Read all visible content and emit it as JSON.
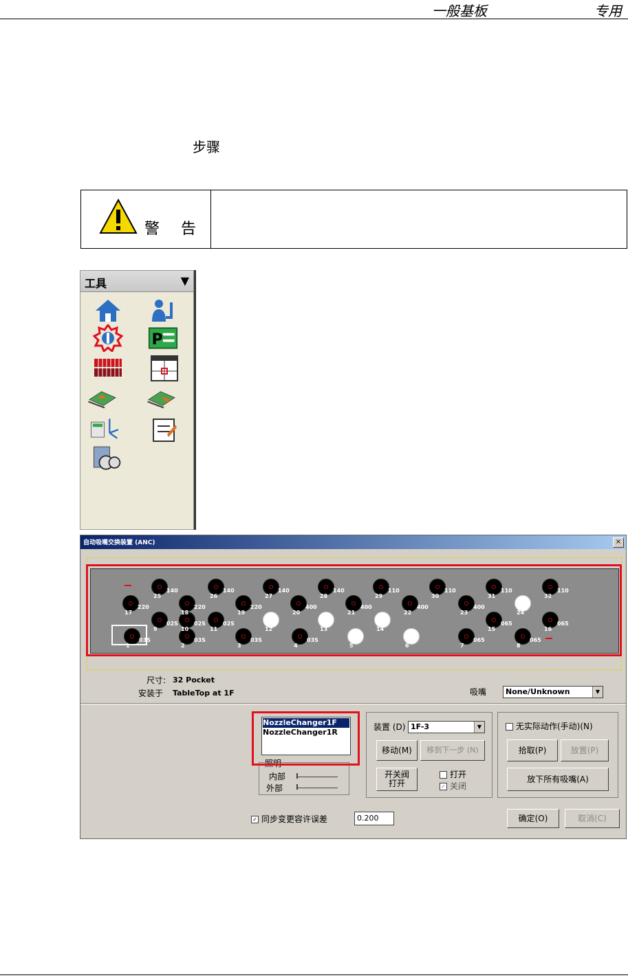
{
  "header": {
    "left": "一般基板",
    "right": "专用"
  },
  "step_title": "步骤",
  "warning": {
    "label": "警 告"
  },
  "tool_panel": {
    "title": "工具",
    "dropdown_arrow": "▼",
    "icons": [
      "home-icon",
      "operator-icon",
      "nozzle-changer-icon",
      "program-icon",
      "feeder-grid-icon",
      "vision-window-icon",
      "board-transfer-icon",
      "board-transfer-2-icon",
      "axis-calibration-icon",
      "checklist-icon",
      "nozzle-stocker-icon"
    ]
  },
  "dialog": {
    "title": "自动吸嘴交换装置 (ANC)",
    "close": "×",
    "pockets": [
      {
        "num": "1",
        "type": "03S",
        "state": "nozzle"
      },
      {
        "num": "2",
        "type": "03S",
        "state": "nozzle"
      },
      {
        "num": "3",
        "type": "03S",
        "state": "nozzle"
      },
      {
        "num": "4",
        "type": "03S",
        "state": "nozzle"
      },
      {
        "num": "5",
        "type": "",
        "state": "empty"
      },
      {
        "num": "6",
        "type": "",
        "state": "empty"
      },
      {
        "num": "7",
        "type": "065",
        "state": "nozzle"
      },
      {
        "num": "8",
        "type": "065",
        "state": "nozzle"
      },
      {
        "num": "9",
        "type": "02S",
        "state": "nozzle"
      },
      {
        "num": "10",
        "type": "02S",
        "state": "nozzle"
      },
      {
        "num": "11",
        "type": "02S",
        "state": "nozzle"
      },
      {
        "num": "12",
        "type": "",
        "state": "empty"
      },
      {
        "num": "13",
        "type": "",
        "state": "empty"
      },
      {
        "num": "14",
        "type": "",
        "state": "empty"
      },
      {
        "num": "15",
        "type": "065",
        "state": "nozzle"
      },
      {
        "num": "16",
        "type": "065",
        "state": "nozzle"
      },
      {
        "num": "17",
        "type": "220",
        "state": "nozzle"
      },
      {
        "num": "18",
        "type": "220",
        "state": "nozzle"
      },
      {
        "num": "19",
        "type": "220",
        "state": "nozzle"
      },
      {
        "num": "20",
        "type": "400",
        "state": "nozzle"
      },
      {
        "num": "21",
        "type": "400",
        "state": "nozzle"
      },
      {
        "num": "22",
        "type": "400",
        "state": "nozzle"
      },
      {
        "num": "23",
        "type": "400",
        "state": "nozzle"
      },
      {
        "num": "24",
        "type": "",
        "state": "empty"
      },
      {
        "num": "25",
        "type": "140",
        "state": "nozzle"
      },
      {
        "num": "26",
        "type": "140",
        "state": "nozzle"
      },
      {
        "num": "27",
        "type": "140",
        "state": "nozzle"
      },
      {
        "num": "28",
        "type": "140",
        "state": "nozzle"
      },
      {
        "num": "29",
        "type": "110",
        "state": "nozzle"
      },
      {
        "num": "30",
        "type": "110",
        "state": "nozzle"
      },
      {
        "num": "31",
        "type": "110",
        "state": "nozzle"
      },
      {
        "num": "32",
        "type": "110",
        "state": "nozzle"
      }
    ],
    "size_label": "尺寸:",
    "size_value": "32 Pocket",
    "mount_label": "安装于",
    "mount_value": "TableTop at 1F",
    "nozzle_label": "吸嘴",
    "nozzle_value": "None/Unknown",
    "changers": [
      "NozzleChanger1F",
      "NozzleChanger1R"
    ],
    "lighting": {
      "title": "照明",
      "inner": "内部",
      "outer": "外部"
    },
    "device_label": "装置 (D)",
    "device_value": "1F-3",
    "move_button": "移动(M)",
    "move_next_button": "移到下一步 (N)",
    "valve_button_line1": "开关阀",
    "valve_button_line2": "打开",
    "open_label": "打开",
    "close_label": "关闭",
    "no_action_label": "无实际动作(手动)(N)",
    "pick_button": "拾取(P)",
    "place_button": "放置(P)",
    "drop_all_button": "放下所有吸嘴(A)",
    "sync_label": "同步变更容许误差",
    "sync_value": "0.200",
    "ok_button": "确定(O)",
    "cancel_button": "取消(C)"
  }
}
